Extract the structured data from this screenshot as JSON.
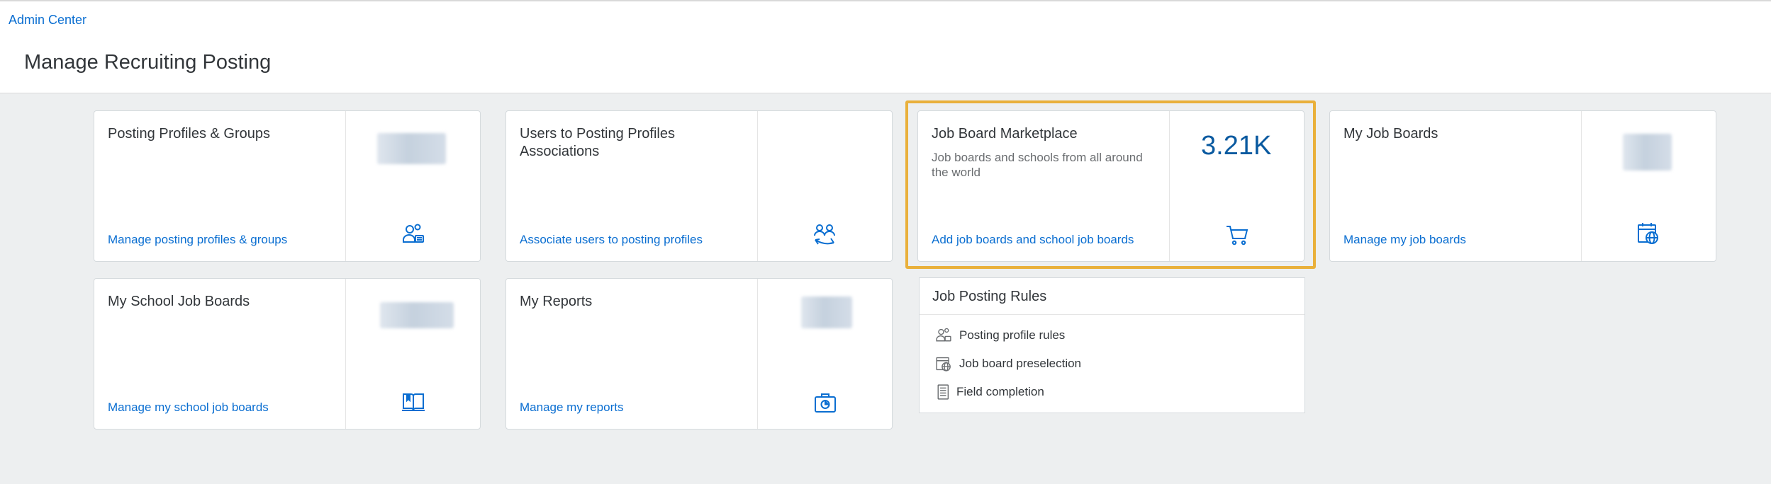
{
  "breadcrumb": {
    "label": "Admin Center"
  },
  "page": {
    "title": "Manage Recruiting Posting"
  },
  "tiles": [
    {
      "title": "Posting Profiles & Groups",
      "link": "Manage posting profiles & groups",
      "icon": "user-group-settings-icon"
    },
    {
      "title": "Users to Posting Profiles Associations",
      "link": "Associate users to posting profiles",
      "icon": "users-exchange-icon"
    },
    {
      "title": "Job Board Marketplace",
      "subtitle": "Job boards and schools from all around the world",
      "kpi": "3.21K",
      "link": "Add job boards and school job boards",
      "icon": "cart-icon"
    },
    {
      "title": "My Job Boards",
      "link": "Manage my job boards",
      "icon": "calendar-globe-icon"
    },
    {
      "title": "My School Job Boards",
      "link": "Manage my school job boards",
      "icon": "open-book-icon"
    },
    {
      "title": "My Reports",
      "link": "Manage my reports",
      "icon": "briefcase-chart-icon"
    }
  ],
  "rules": {
    "title": "Job Posting Rules",
    "items": [
      {
        "label": "Posting profile rules",
        "icon": "user-group-settings-icon"
      },
      {
        "label": "Job board preselection",
        "icon": "calendar-globe-icon"
      },
      {
        "label": "Field completion",
        "icon": "form-icon"
      }
    ]
  },
  "colors": {
    "accent": "#0a6ed1",
    "highlight": "#e9b03b",
    "kpi": "#0a5aa0",
    "background": "#edeff0"
  }
}
